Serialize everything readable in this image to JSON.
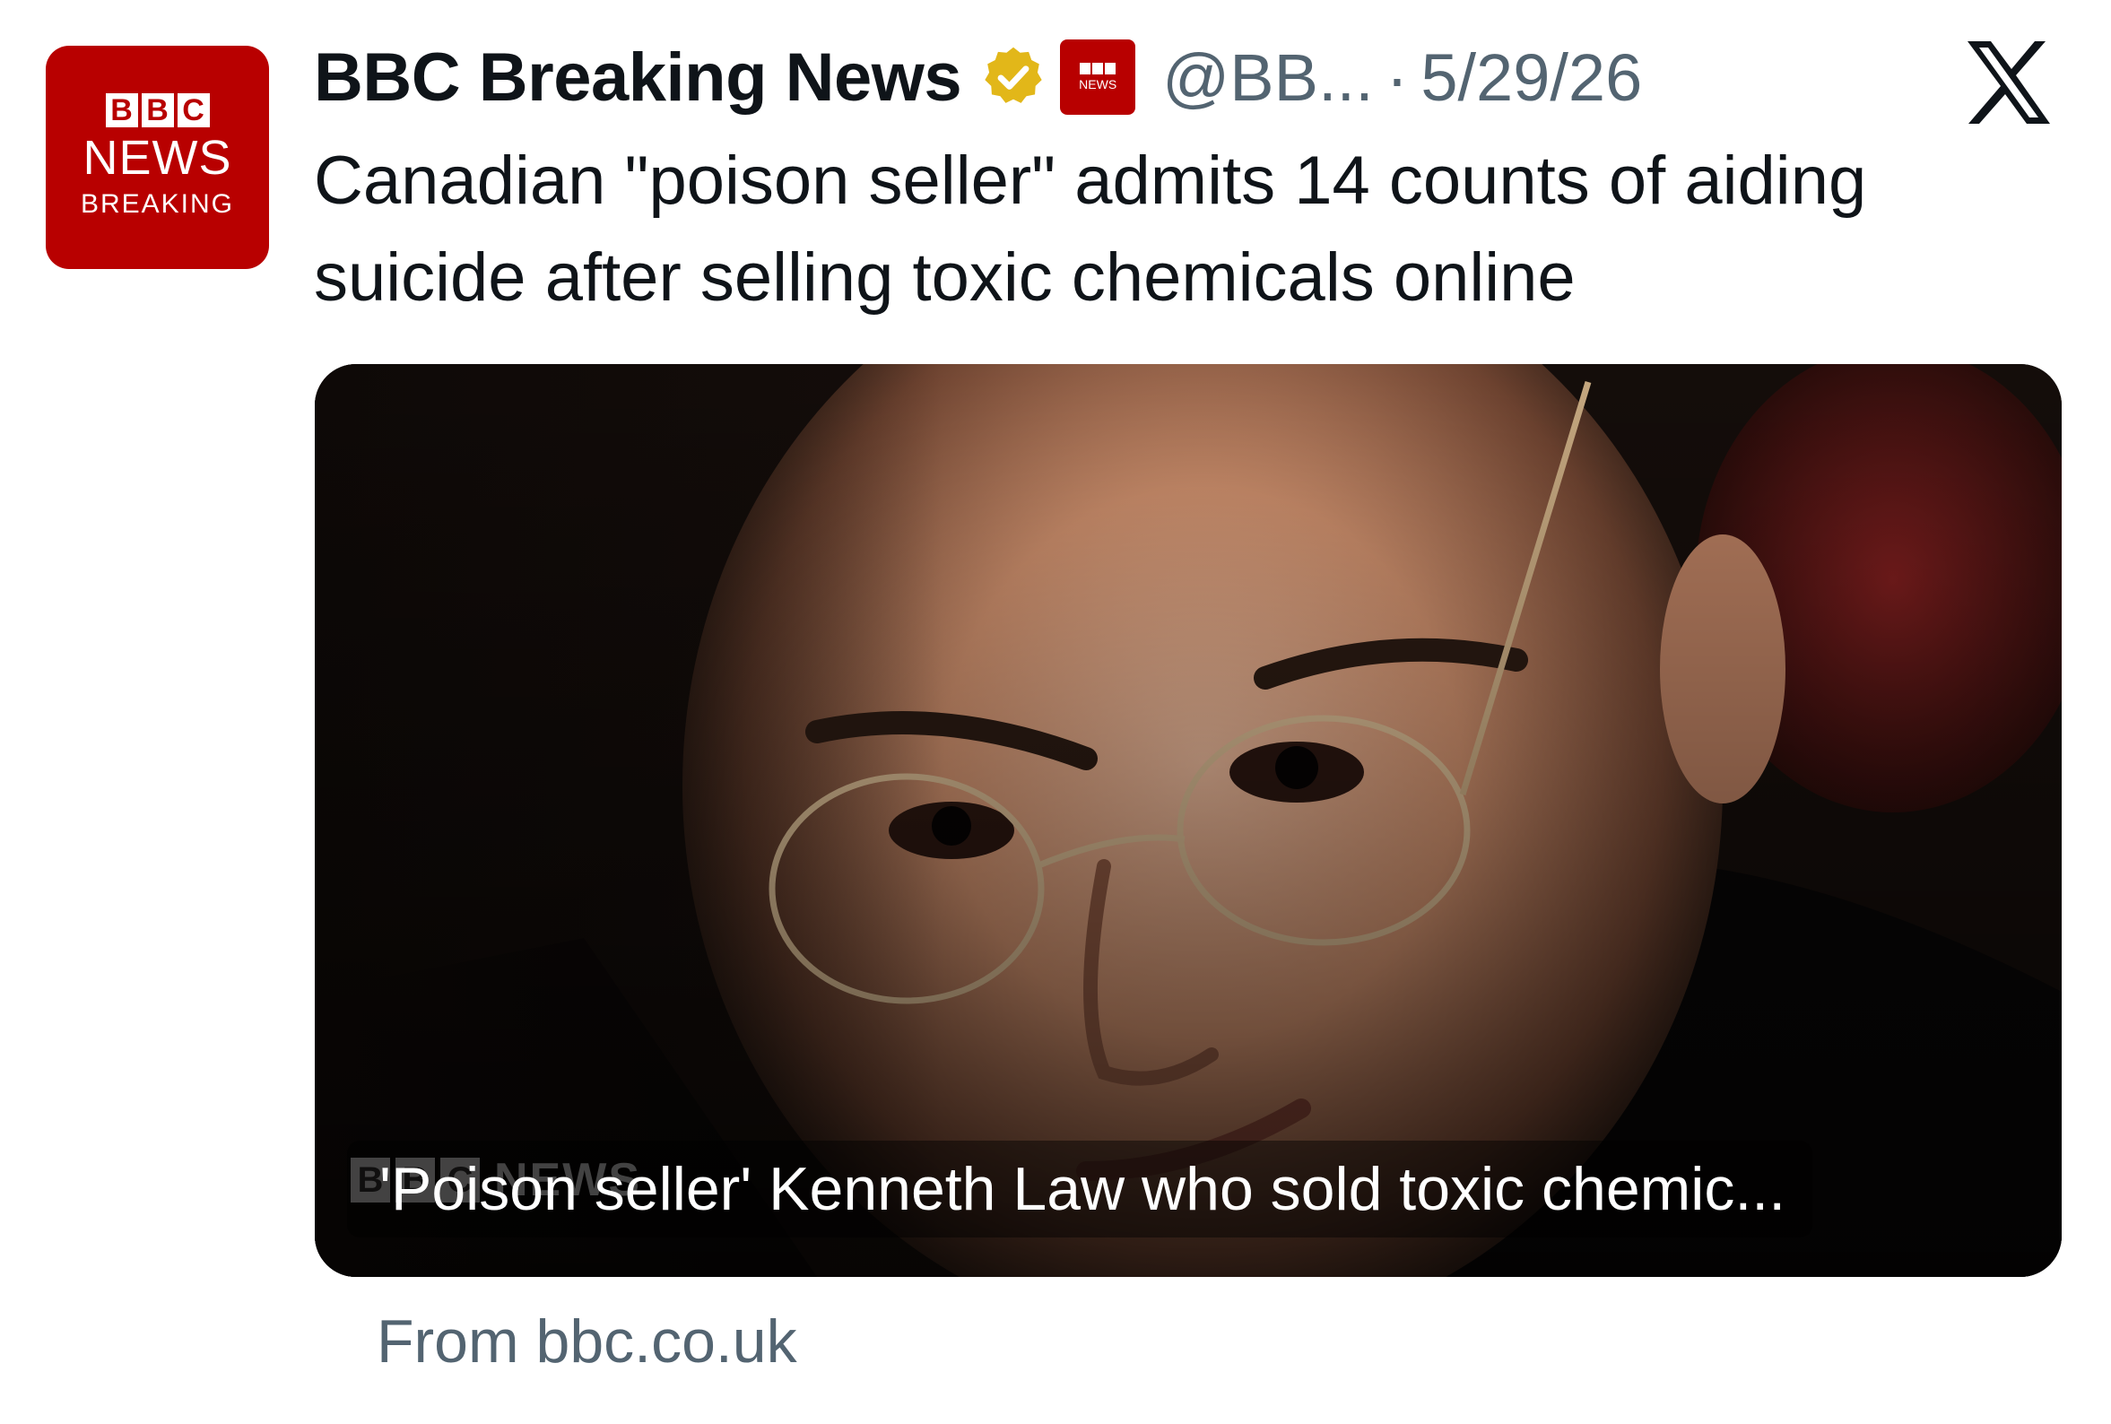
{
  "avatar": {
    "blocks": [
      "B",
      "B",
      "C"
    ],
    "line1": "NEWS",
    "line2": "BREAKING"
  },
  "header": {
    "display_name": "BBC Breaking News",
    "verified_badge": "gold-verified-badge",
    "affiliate_badge": {
      "blocks": [
        "",
        "",
        ""
      ],
      "text": "NEWS"
    },
    "handle": "@BB...",
    "separator": "·",
    "date": "5/29/26"
  },
  "tweet": {
    "text": "Canadian \"poison seller\" admits 14 counts of aiding suicide after selling toxic chemicals online"
  },
  "media": {
    "watermark_blocks": [
      "B",
      "B",
      "C"
    ],
    "watermark_text": "NEWS",
    "caption": "'Poison seller' Kenneth Law who sold toxic chemic..."
  },
  "source": {
    "text": "From bbc.co.uk"
  },
  "colors": {
    "bbc_red": "#b80000",
    "verified_gold": "#e2b719",
    "text_primary": "#0f1419",
    "text_secondary": "#536471"
  },
  "icons": {
    "platform": "x-logo-icon",
    "verified": "verified-badge-icon"
  }
}
